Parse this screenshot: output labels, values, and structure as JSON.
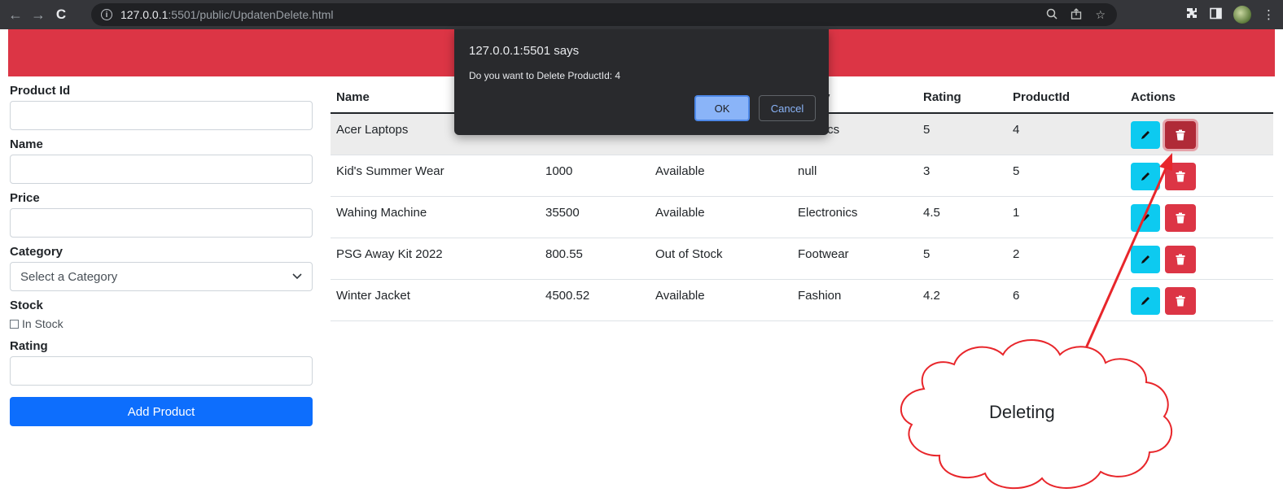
{
  "browser": {
    "url_host": "127.0.0.1",
    "url_rest": ":5501/public/UpdatenDelete.html"
  },
  "form": {
    "product_id_label": "Product Id",
    "name_label": "Name",
    "price_label": "Price",
    "category_label": "Category",
    "category_selected": "Select a Category",
    "stock_label": "Stock",
    "in_stock_label": "In Stock",
    "rating_label": "Rating",
    "add_button": "Add Product"
  },
  "table": {
    "headers": [
      "Name",
      "",
      "",
      "Category",
      "Rating",
      "ProductId",
      "Actions"
    ],
    "header_category_visible": "gory",
    "rows": [
      {
        "name": "Acer Laptops",
        "price": "",
        "stock": "",
        "category": "tronics",
        "rating": "5",
        "id": "4"
      },
      {
        "name": "Kid's Summer Wear",
        "price": "1000",
        "stock": "Available",
        "category": "null",
        "rating": "3",
        "id": "5"
      },
      {
        "name": "Wahing Machine",
        "price": "35500",
        "stock": "Available",
        "category": "Electronics",
        "rating": "4.5",
        "id": "1"
      },
      {
        "name": "PSG Away Kit 2022",
        "price": "800.55",
        "stock": "Out of Stock",
        "category": "Footwear",
        "rating": "5",
        "id": "2"
      },
      {
        "name": "Winter Jacket",
        "price": "4500.52",
        "stock": "Available",
        "category": "Fashion",
        "rating": "4.2",
        "id": "6"
      }
    ]
  },
  "dialog": {
    "title": "127.0.0.1:5501 says",
    "message": "Do you want to Delete ProductId: 4",
    "ok": "OK",
    "cancel": "Cancel"
  },
  "annotation": {
    "text": "Deleting",
    "color": "#e8262b"
  },
  "colors": {
    "header_band": "#dc3545",
    "primary": "#0d6efd",
    "edit": "#0dcaf0",
    "delete": "#dc3545"
  }
}
